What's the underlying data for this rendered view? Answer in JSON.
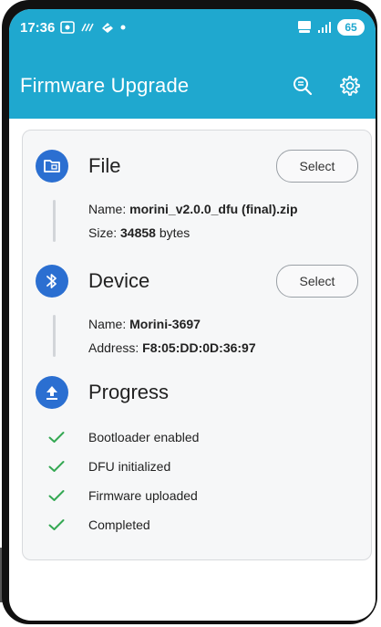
{
  "status": {
    "time": "17:36",
    "battery": "65",
    "colors": {
      "bar": "#1fa8cf"
    }
  },
  "header": {
    "title": "Firmware Upgrade",
    "icons": [
      "search-log-icon",
      "gear-icon"
    ]
  },
  "file": {
    "title": "File",
    "select_label": "Select",
    "name_label": "Name:",
    "name_value": "morini_v2.0.0_dfu (final).zip",
    "size_label": "Size:",
    "size_value": "34858",
    "size_unit": "bytes"
  },
  "device": {
    "title": "Device",
    "select_label": "Select",
    "name_label": "Name:",
    "name_value": "Morini-3697",
    "address_label": "Address:",
    "address_value": "F8:05:DD:0D:36:97"
  },
  "progress": {
    "title": "Progress",
    "steps": [
      {
        "label": "Bootloader enabled",
        "status": "done"
      },
      {
        "label": "DFU initialized",
        "status": "done"
      },
      {
        "label": "Firmware uploaded",
        "status": "done"
      },
      {
        "label": "Completed",
        "status": "done"
      }
    ]
  },
  "colors": {
    "accent": "#2b6fd1",
    "check": "#34a853",
    "appbar": "#1fa8cf"
  }
}
